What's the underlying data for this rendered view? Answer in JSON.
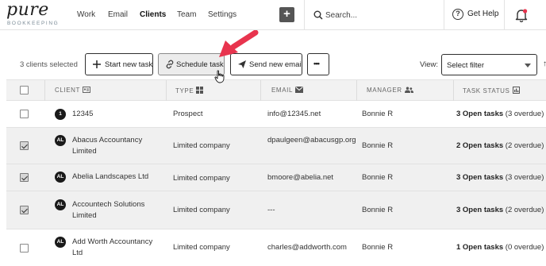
{
  "brand": {
    "name": "pure",
    "tagline": "BOOKKEEPING"
  },
  "nav": {
    "items": [
      {
        "label": "Work",
        "active": false
      },
      {
        "label": "Email",
        "active": false
      },
      {
        "label": "Clients",
        "active": true
      },
      {
        "label": "Team",
        "active": false
      },
      {
        "label": "Settings",
        "active": false
      }
    ],
    "add_label": "+",
    "search_placeholder": "Search...",
    "help_label": "Get Help",
    "help_icon": "?"
  },
  "toolbar": {
    "selected_count": "3 clients selected",
    "start_task_label": "Start new task",
    "schedule_task_label": "Schedule task",
    "send_email_label": "Send new email",
    "more_label": "•••",
    "view_label": "View:",
    "filter_value": "Select filter",
    "overflow_arrow": "↑"
  },
  "table": {
    "headers": {
      "client": "CLIENT",
      "type": "TYPE",
      "email": "EMAIL",
      "manager": "MANAGER",
      "task_status": "TASK STATUS"
    },
    "rows": [
      {
        "avatar": "1",
        "client": "12345",
        "type": "Prospect",
        "email": "info@12345.net",
        "manager": "Bonnie R",
        "tasks_bold": "3 Open tasks",
        "tasks_rest": " (3 overdue)",
        "checked": false
      },
      {
        "avatar": "AL",
        "client": "Abacus Accountancy Limited",
        "type": "Limited company",
        "email": "dpaulgeen@abacusgp.org",
        "manager": "Bonnie R",
        "tasks_bold": "2 Open tasks",
        "tasks_rest": " (2 overdue)",
        "checked": true
      },
      {
        "avatar": "AL",
        "client": "Abelia Landscapes Ltd",
        "type": "Limited company",
        "email": "bmoore@abelia.net",
        "manager": "Bonnie R",
        "tasks_bold": "3 Open tasks",
        "tasks_rest": " (3 overdue)",
        "checked": true
      },
      {
        "avatar": "AL",
        "client": "Accountech Solutions Limited",
        "type": "Limited company",
        "email": "---",
        "manager": "Bonnie R",
        "tasks_bold": "3 Open tasks",
        "tasks_rest": " (2 overdue)",
        "checked": true
      },
      {
        "avatar": "AL",
        "client": "Add Worth Accountancy Ltd",
        "type": "Limited company",
        "email": "charles@addworth.com",
        "manager": "Bonnie R",
        "tasks_bold": "1 Open tasks",
        "tasks_rest": " (0 overdue)",
        "checked": false
      }
    ]
  },
  "colors": {
    "annotation_arrow": "#e8344e",
    "avatar_bg": "#1a1a1a",
    "selected_row_bg": "#f0f0f0"
  }
}
